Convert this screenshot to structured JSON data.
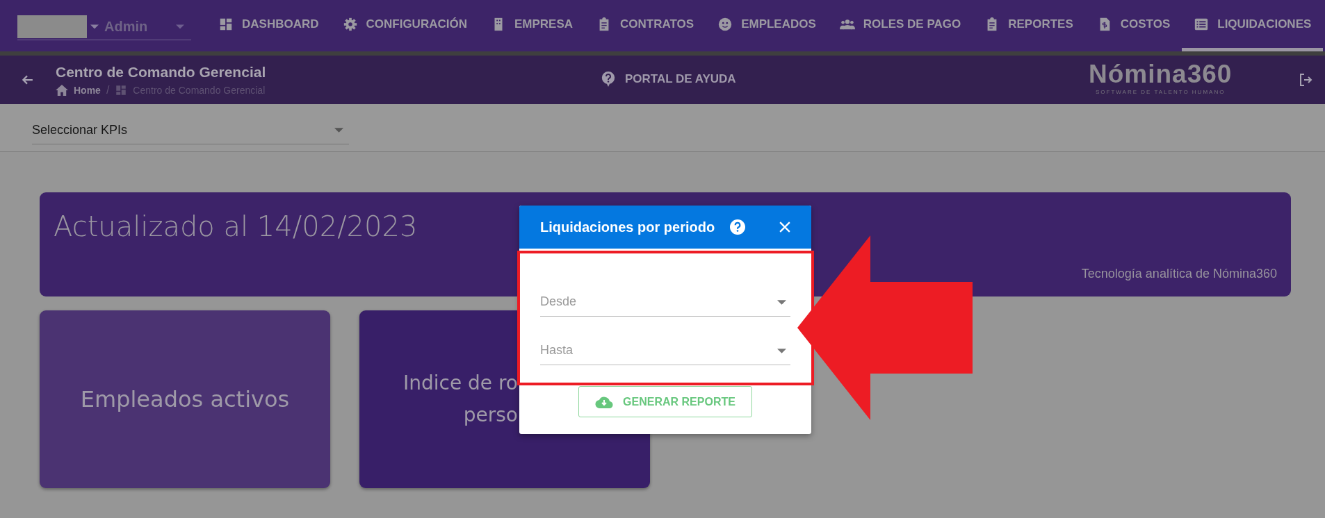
{
  "user": {
    "role": "Admin"
  },
  "nav": [
    {
      "label": "DASHBOARD",
      "selected": false
    },
    {
      "label": "CONFIGURACIÓN",
      "selected": false
    },
    {
      "label": "EMPRESA",
      "selected": false
    },
    {
      "label": "CONTRATOS",
      "selected": false
    },
    {
      "label": "EMPLEADOS",
      "selected": false
    },
    {
      "label": "ROLES DE PAGO",
      "selected": false
    },
    {
      "label": "REPORTES",
      "selected": false
    },
    {
      "label": "COSTOS",
      "selected": false
    },
    {
      "label": "LIQUIDACIONES",
      "selected": true
    }
  ],
  "page_header": {
    "title": "Centro de Comando Gerencial",
    "breadcrumb": [
      "Home",
      "Centro de Comando Gerencial"
    ],
    "breadcrumb_separator": "/",
    "help_link": "PORTAL DE AYUDA",
    "logo": "Nómina360",
    "logo_tagline": "SOFTWARE DE TALENTO HUMANO"
  },
  "kpi_select": {
    "value": "Seleccionar KPIs"
  },
  "banner": {
    "title": "Actualizado al 14/02/2023",
    "footer": "Tecnología analítica de Nómina360"
  },
  "cards": [
    {
      "lines": [
        "Empleados activos"
      ]
    },
    {
      "lines": [
        "Indice de ro",
        "perso"
      ]
    }
  ],
  "dialog": {
    "title": "Liquidaciones por periodo",
    "fields": [
      {
        "placeholder": "Desde"
      },
      {
        "placeholder": "Hasta"
      }
    ],
    "button": "GENERAR REPORTE"
  }
}
